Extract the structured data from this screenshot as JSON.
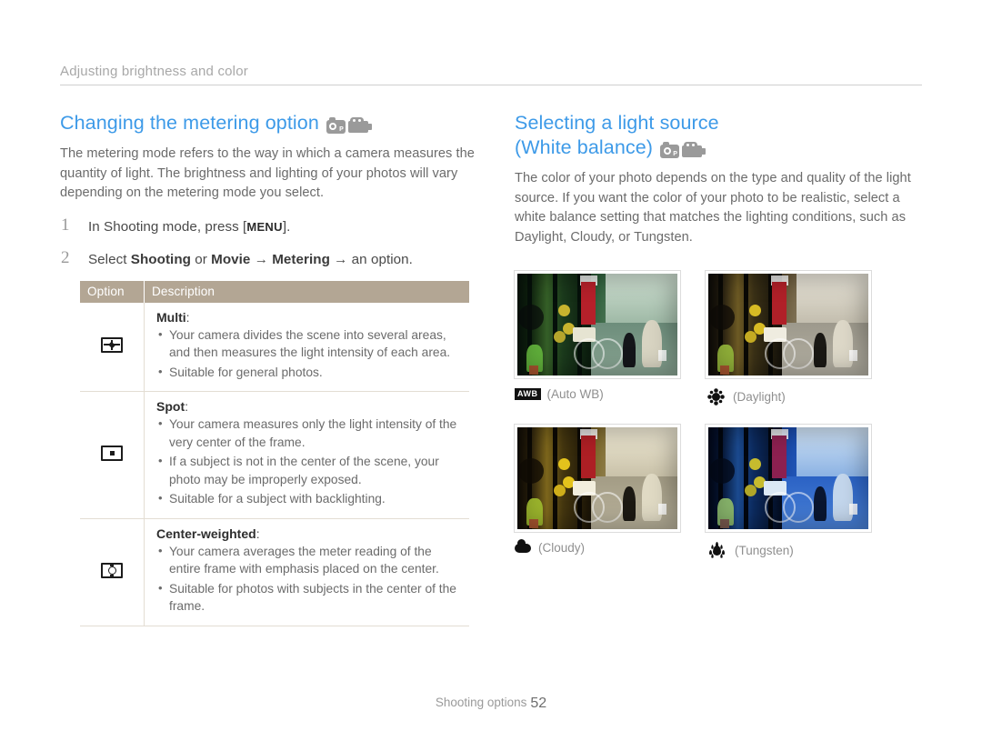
{
  "breadcrumb": "Adjusting brightness and color",
  "left_column": {
    "title": "Changing the metering option",
    "mode_icons": [
      "camera-p-icon",
      "camcorder-icon"
    ],
    "intro": "The metering mode refers to the way in which a camera measures the quantity of light. The brightness and lighting of your photos will vary depending on the metering mode you select.",
    "steps": [
      {
        "number": "1",
        "prefix": "In Shooting mode, press [",
        "key": "MENU",
        "suffix": "]."
      },
      {
        "number": "2",
        "text_parts": [
          "Select ",
          "Shooting",
          " or ",
          "Movie",
          " → ",
          "Metering",
          " → an option."
        ]
      }
    ],
    "table": {
      "headers": [
        "Option",
        "Description"
      ],
      "rows": [
        {
          "icon": "metering-multi-icon",
          "name": "Multi",
          "bullets": [
            "Your camera divides the scene into several areas, and then measures the light intensity of each area.",
            "Suitable for general photos."
          ]
        },
        {
          "icon": "metering-spot-icon",
          "name": "Spot",
          "bullets": [
            "Your camera measures only the light intensity of the very center of the frame.",
            "If a subject is not in the center of the scene, your photo may be improperly exposed.",
            "Suitable for a subject with backlighting."
          ]
        },
        {
          "icon": "metering-center-weighted-icon",
          "name": "Center-weighted",
          "bullets": [
            "Your camera averages the meter reading of the entire frame with emphasis placed on the center.",
            "Suitable for photos with subjects in the center of the frame."
          ]
        }
      ]
    }
  },
  "right_column": {
    "title_line1": "Selecting a light source",
    "title_line2": "(White balance)",
    "mode_icons": [
      "camera-p-icon",
      "camcorder-icon"
    ],
    "intro": "The color of your photo depends on the type and quality of the light source. If you want the color of your photo to be realistic, select a white balance setting that matches the lighting conditions, such as Daylight, Cloudy, or Tungsten.",
    "samples": [
      {
        "icon": "awb-icon",
        "caption": "(Auto WB)",
        "tint": "#2e6b4e",
        "photo_desc": "narrow alley with shop window, bicycle and two pedestrians, green cast"
      },
      {
        "icon": "daylight-sun-icon",
        "caption": "(Daylight)",
        "tint": "#7a6a52",
        "photo_desc": "narrow alley with shop window, bicycle and two pedestrians, neutral warm"
      },
      {
        "icon": "cloudy-icon",
        "caption": "(Cloudy)",
        "tint": "#8a7545",
        "photo_desc": "narrow alley with shop window, bicycle and two pedestrians, warm yellow cast"
      },
      {
        "icon": "tungsten-icon",
        "caption": "(Tungsten)",
        "tint": "#1f4fb5",
        "photo_desc": "narrow alley with shop window, bicycle and two pedestrians, strong blue cast"
      }
    ]
  },
  "footer": {
    "label": "Shooting options",
    "page": "52"
  },
  "colors": {
    "heading_blue": "#3d9ae8",
    "table_header_tan": "#b3a694",
    "body_gray": "#6b6b6b",
    "breadcrumb_gray": "#a8a8a8"
  }
}
